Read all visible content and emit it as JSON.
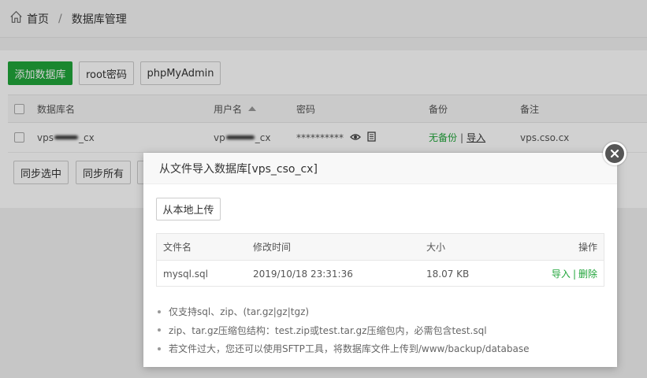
{
  "breadcrumb": {
    "home": "首页",
    "separator": "/",
    "current": "数据库管理"
  },
  "toolbar": {
    "add_db": "添加数据库",
    "root_pwd": "root密码",
    "phpmyadmin": "phpMyAdmin"
  },
  "db_table": {
    "headers": {
      "name": "数据库名",
      "user": "用户名",
      "password": "密码",
      "backup": "备份",
      "note": "备注"
    },
    "row": {
      "name_prefix": "vps",
      "name_suffix": "_cx",
      "user_prefix": "vp",
      "user_suffix": "_cx",
      "password": "**********",
      "backup_status": "无备份",
      "backup_sep": "|",
      "backup_import": "导入",
      "note": "vps.cso.cx"
    }
  },
  "bottom_actions": {
    "sync_selected": "同步选中",
    "sync_all": "同步所有"
  },
  "modal": {
    "title": "从文件导入数据库[vps_cso_cx]",
    "upload_label": "从本地上传",
    "file_table": {
      "headers": {
        "name": "文件名",
        "mtime": "修改时间",
        "size": "大小",
        "action": "操作"
      },
      "rows": [
        {
          "name": "mysql.sql",
          "mtime": "2019/10/18 23:31:36",
          "size": "18.07 KB",
          "import": "导入",
          "sep": "|",
          "delete": "删除"
        }
      ]
    },
    "tips": [
      "仅支持sql、zip、(tar.gz|gz|tgz)",
      "zip、tar.gz压缩包结构：test.zip或test.tar.gz压缩包内，必需包含test.sql",
      "若文件过大，您还可以使用SFTP工具，将数据库文件上传到/www/backup/database"
    ]
  },
  "colors": {
    "accent": "#20a53a",
    "overlay": "rgba(0,0,0,0.18)"
  }
}
